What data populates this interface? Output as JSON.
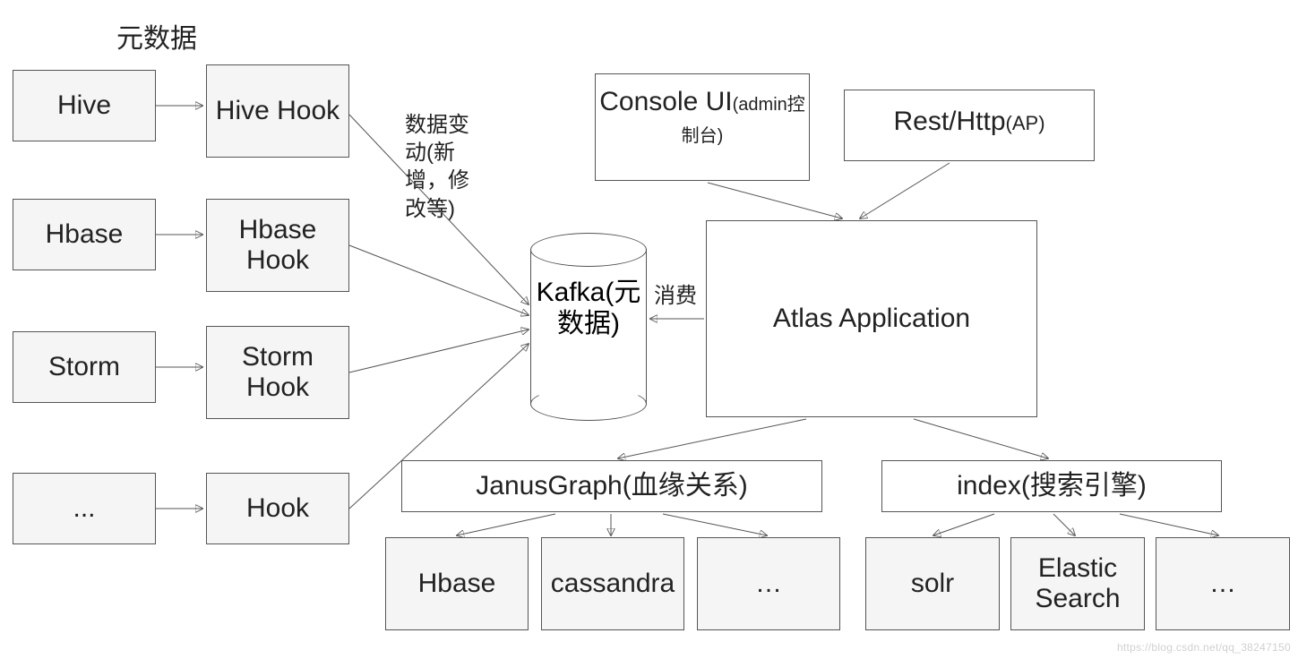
{
  "title": "元数据",
  "sources": {
    "hive": "Hive",
    "hbase": "Hbase",
    "storm": "Storm",
    "more": "..."
  },
  "hooks": {
    "hive": "Hive Hook",
    "hbase": "Hbase Hook",
    "storm": "Storm Hook",
    "generic": "Hook"
  },
  "edge_labels": {
    "hook_to_kafka": "数据变动(新增，修改等)",
    "kafka_to_atlas": "消费"
  },
  "kafka": "Kafka(元数据)",
  "frontends": {
    "console_main": "Console UI",
    "console_sub": "(admin控制台)",
    "rest_main": "Rest/Http",
    "rest_sub": "(AP)"
  },
  "atlas": "Atlas Application",
  "graph": {
    "label": "JanusGraph(血缘关系)",
    "backends": {
      "hbase": "Hbase",
      "cassandra": "cassandra",
      "more": "…"
    }
  },
  "index": {
    "label": "index(搜索引擎)",
    "backends": {
      "solr": "solr",
      "es": "Elastic Search",
      "more": "…"
    }
  },
  "watermark": "https://blog.csdn.net/qq_38247150"
}
